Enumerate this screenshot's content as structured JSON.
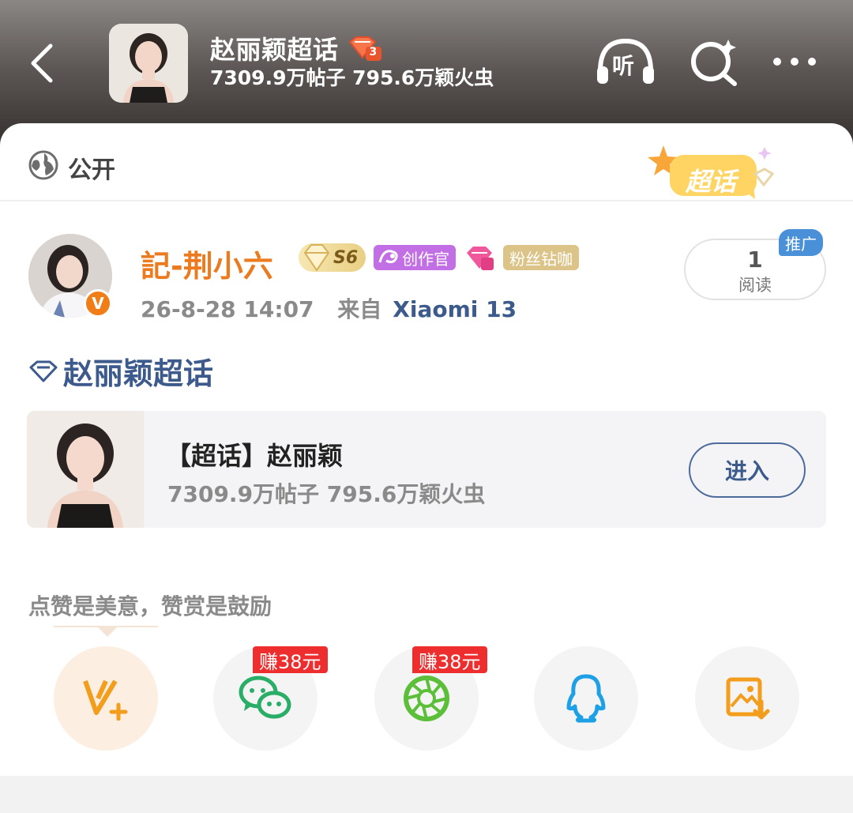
{
  "header": {
    "title": "赵丽颖超话",
    "level_badge": "3",
    "stats": "7309.9万帖子 795.6万颖火虫",
    "listen_label": "听"
  },
  "post": {
    "visibility": "公开",
    "sticker_label": "超话",
    "author": {
      "name": "記-荆小六",
      "level": "S6",
      "creator_badge": "创作官",
      "fan_badge": "粉丝钻咖",
      "verified": "V"
    },
    "time": "26-8-28 14:07",
    "from_label": "来自",
    "device": "Xiaomi 13",
    "read": {
      "count": "1",
      "label": "阅读",
      "promo": "推广"
    },
    "topic": "赵丽颖超话"
  },
  "topic_card": {
    "title": "【超话】赵丽颖",
    "stats": "7309.9万帖子 795.6万颖火虫",
    "enter_label": "进入"
  },
  "share": {
    "prompt": "点赞是美意，赞赏是鼓励",
    "earn_wechat": "赚38元",
    "earn_moments": "赚38元",
    "icons": [
      "v-plus-icon",
      "wechat-icon",
      "moments-icon",
      "qq-icon",
      "save-image-icon"
    ]
  },
  "colors": {
    "author": "#ec7a1e",
    "link_blue": "#3d5a8c",
    "earn_red": "#ee2e2e",
    "wechat_green": "#2aae67",
    "moments_green": "#5cbf3a",
    "qq_blue": "#1ea0e6",
    "save_orange": "#f29d1c"
  }
}
